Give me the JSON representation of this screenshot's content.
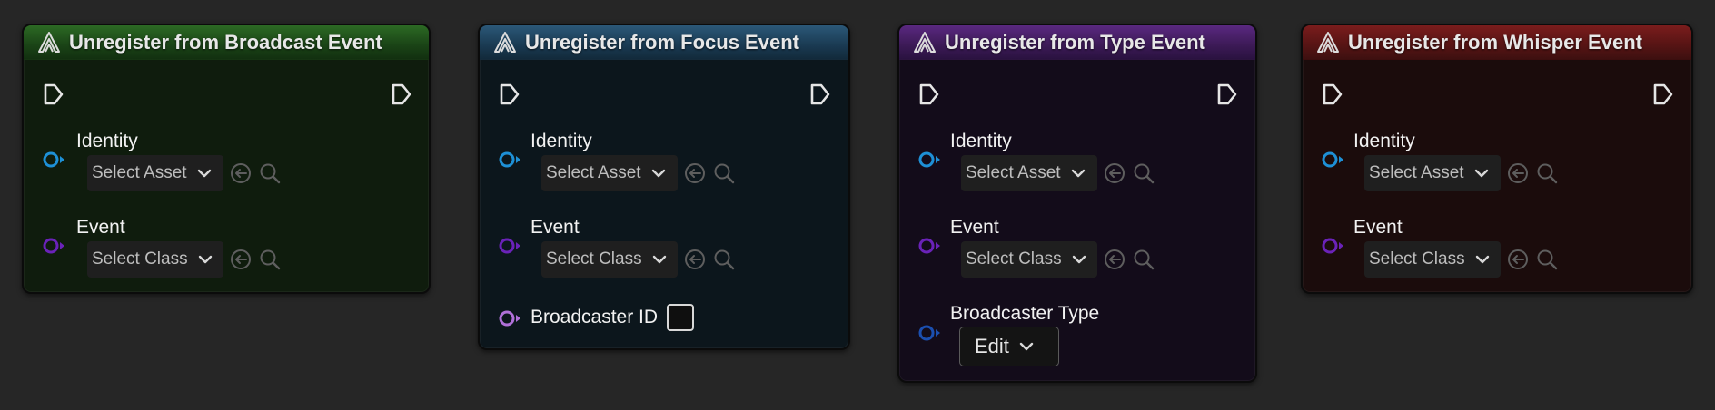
{
  "nodes": [
    {
      "title": "Unregister from Broadcast Event",
      "header_color": "#1d4a1a",
      "body_color": "#0f1c0d",
      "identity": {
        "label": "Identity",
        "select": "Select Asset",
        "pin_color": "#1e90d6"
      },
      "event": {
        "label": "Event",
        "select": "Select Class",
        "pin_color": "#6a22b8"
      }
    },
    {
      "title": "Unregister from Focus Event",
      "header_color": "#1b3c52",
      "body_color": "#0c161c",
      "identity": {
        "label": "Identity",
        "select": "Select Asset",
        "pin_color": "#1e90d6"
      },
      "event": {
        "label": "Event",
        "select": "Select Class",
        "pin_color": "#6a22b8"
      },
      "extra": {
        "label": "Broadcaster ID",
        "pin_color": "#b070d8",
        "checked": false
      }
    },
    {
      "title": "Unregister from Type Event",
      "header_color": "#3b1954",
      "body_color": "#130c1a",
      "identity": {
        "label": "Identity",
        "select": "Select Asset",
        "pin_color": "#1e90d6"
      },
      "event": {
        "label": "Event",
        "select": "Select Class",
        "pin_color": "#6a22b8"
      },
      "extra": {
        "label": "Broadcaster Type",
        "pin_color": "#1b4fb0",
        "button": "Edit"
      }
    },
    {
      "title": "Unregister from Whisper Event",
      "header_color": "#5a1515",
      "body_color": "#1b0c0c",
      "identity": {
        "label": "Identity",
        "select": "Select Asset",
        "pin_color": "#1e90d6"
      },
      "event": {
        "label": "Event",
        "select": "Select Class",
        "pin_color": "#6a22b8"
      }
    }
  ],
  "icons": {
    "logo": "unreal-a-logo-icon",
    "exec_in": "exec-pin-in-icon",
    "exec_out": "exec-pin-out-icon",
    "use_selected": "use-selected-arrow-icon",
    "browse": "magnifier-browse-icon",
    "dropdown": "chevron-down-icon"
  }
}
